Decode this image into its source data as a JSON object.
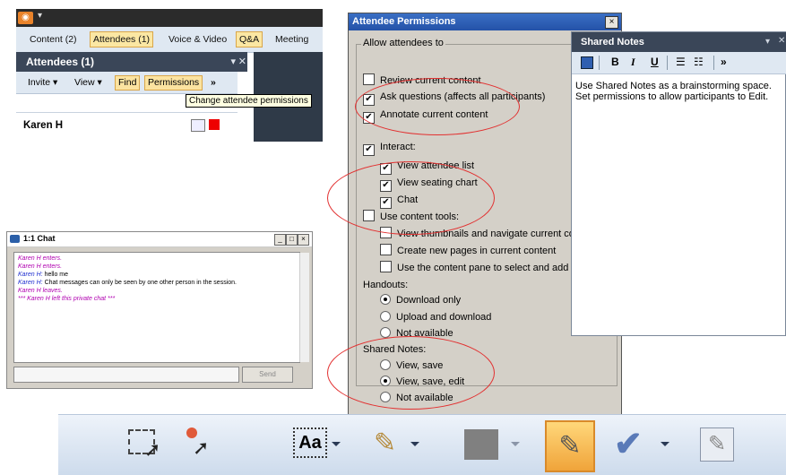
{
  "attendees_panel": {
    "tabs": [
      {
        "label": "Content (2)"
      },
      {
        "label": "Attendees (1)"
      },
      {
        "label": "Voice & Video"
      },
      {
        "label": "Q&A"
      },
      {
        "label": "Meeting"
      }
    ],
    "title": "Attendees (1)",
    "toolbar": {
      "invite": "Invite",
      "view": "View",
      "find": "Find",
      "permissions": "Permissions",
      "more": "»"
    },
    "attendee_name": "Karen H",
    "tooltip": "Change attendee permissions"
  },
  "chat_window": {
    "title": "1:1 Chat",
    "lines": [
      {
        "text": "Karen H enters.",
        "style": "pur"
      },
      {
        "text": " Karen H enters.",
        "style": "pur"
      },
      {
        "name": "Karen H:",
        "text": " hello me"
      },
      {
        "name": "Karen H:",
        "text": " Chat messages can only be seen by one other person in the session."
      },
      {
        "text": "Karen H leaves.",
        "style": "pur"
      },
      {
        "text": "*** Karen H left this private chat ***",
        "style": "pur"
      }
    ],
    "send_label": "Send"
  },
  "permissions_dialog": {
    "title": "Attendee Permissions",
    "close": "×",
    "group_label": "Allow attendees to",
    "items": {
      "review": "Review current content",
      "ask": "Ask questions (affects all participants)",
      "annotate": "Annotate current content",
      "interact": "Interact:",
      "view_attendee_list": "View attendee list",
      "view_seating_chart": "View seating chart",
      "chat": "Chat",
      "use_content_tools": "Use content tools:",
      "view_thumbnails": "View thumbnails and navigate current cor",
      "create_pages": "Create new pages in current content",
      "use_content_pane": "Use the content pane to select and add c"
    },
    "handouts_label": "Handouts:",
    "handouts": [
      "Download only",
      "Upload and download",
      "Not available"
    ],
    "shared_notes_label": "Shared Notes:",
    "shared_notes": [
      "View, save",
      "View, save, edit",
      "Not available"
    ]
  },
  "shared_notes": {
    "title": "Shared Notes",
    "toolbar": {
      "bold": "B",
      "italic": "I",
      "underline": "U",
      "more": "»"
    },
    "body": "Use Shared Notes as a brainstorming space.  Set permissions to allow participants to Edit."
  },
  "colors": {
    "accent": "#3a4658",
    "highlight": "#fbe7a3",
    "annotation_circle": "#e23030",
    "dialog_bg": "#d4d0c8"
  }
}
